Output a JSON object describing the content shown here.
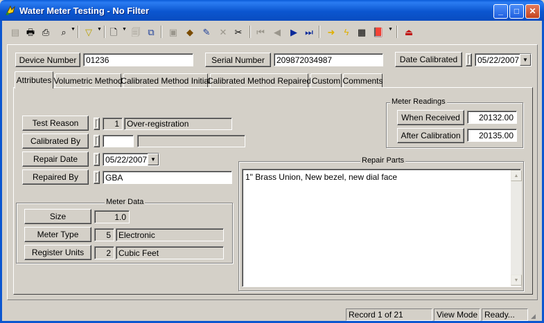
{
  "window": {
    "title": "Water Meter Testing - No Filter",
    "minimize": "_",
    "maximize": "□",
    "close": "✕"
  },
  "toolbar": {
    "icons": [
      "record-icon",
      "print-icon",
      "print-preview-icon",
      "binoculars-icon",
      "filter-icon",
      "new-record-icon",
      "copy-record-icon",
      "duplicate-icon",
      "save-icon",
      "attach-icon",
      "edit-icon",
      "delete-icon",
      "cut-icon",
      "first-icon",
      "previous-icon",
      "next-icon",
      "last-icon",
      "goto-icon",
      "flash-icon",
      "report-icon",
      "book-icon",
      "exit-icon"
    ]
  },
  "header": {
    "device_number_label": "Device Number",
    "device_number": "01236",
    "serial_number_label": "Serial Number",
    "serial_number": "209872034987",
    "date_calibrated_label": "Date Calibrated",
    "date_calibrated": "05/22/2007"
  },
  "tabs": [
    {
      "label": "Attributes"
    },
    {
      "label": "Volumetric Method"
    },
    {
      "label": "Calibrated Method Initial"
    },
    {
      "label": "Calibrated Method Repaired"
    },
    {
      "label": "Custom"
    },
    {
      "label": "Comments"
    }
  ],
  "attributes": {
    "test_reason_label": "Test Reason",
    "test_reason_code": "1",
    "test_reason": "Over-registration",
    "calibrated_by_label": "Calibrated By",
    "calibrated_by_code": "",
    "calibrated_by": "",
    "repair_date_label": "Repair Date",
    "repair_date": "05/22/2007",
    "repaired_by_label": "Repaired By",
    "repaired_by": "GBA"
  },
  "meter_readings": {
    "title": "Meter Readings",
    "when_received_label": "When Received",
    "when_received": "20132.00",
    "after_calibration_label": "After Calibration",
    "after_calibration": "20135.00"
  },
  "repair_parts": {
    "title": "Repair Parts",
    "text": "1\" Brass Union, New bezel, new dial face"
  },
  "meter_data": {
    "title": "Meter Data",
    "size_label": "Size",
    "size": "1.0",
    "meter_type_label": "Meter Type",
    "meter_type_code": "5",
    "meter_type": "Electronic",
    "register_units_label": "Register Units",
    "register_units_code": "2",
    "register_units": "Cubic Feet"
  },
  "status": {
    "record": "Record 1 of 21",
    "mode": "View Mode",
    "state": "Ready..."
  }
}
